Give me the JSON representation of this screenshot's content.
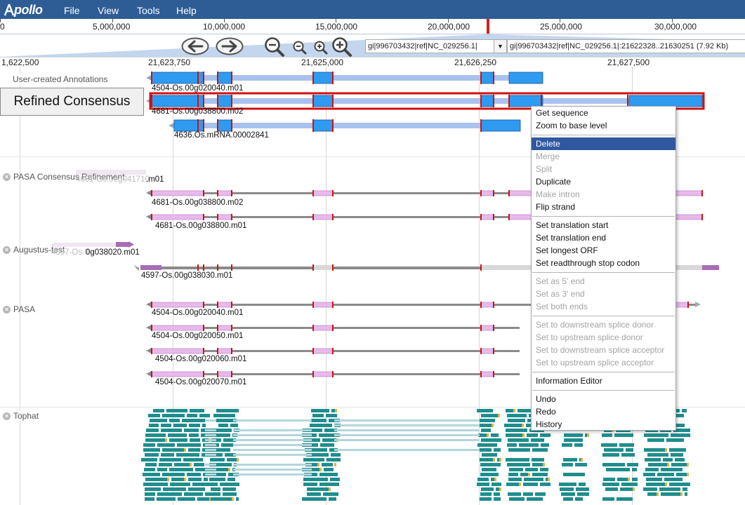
{
  "app": {
    "name": "Apollo",
    "logo_text": "pollo"
  },
  "menu": [
    "File",
    "View",
    "Tools",
    "Help"
  ],
  "overview": {
    "tick_labels": [
      "0",
      "5,000,000",
      "10,000,000",
      "15,000,000",
      "20,000,000",
      "25,000,000",
      "30,000,000"
    ]
  },
  "navigation": {
    "reference_sequence": "gi|996703432|ref|NC_029256.1|",
    "location": "gi|996703432|ref|NC_029256.1|:21622328..21630251 (7.92 Kb)"
  },
  "ruler": {
    "labels": [
      "1,622,500",
      "21,623,750",
      "21,625,000",
      "21,626,250",
      "21,627,500"
    ]
  },
  "highlight_label": "Refined Consensus",
  "tracks": {
    "user": {
      "label": "User-created Annotations",
      "features": [
        "4504-Os.00g020040.m01",
        "4681-Os.00g038800.m02",
        "4636.Os.mRNA.00002841"
      ]
    },
    "pasa_refine": {
      "label": "PASA Consensus Refinement",
      "ghost": "4681-Os.00g041710",
      "ghost_tail": ".m01",
      "features": [
        "4681-Os.00g038800.m02",
        "4681-Os.00g038800.m01"
      ]
    },
    "augustus": {
      "label": "Augustus-test",
      "ghost": "4597-Os.0",
      "ghost_tail": "0g038020.m01",
      "features": [
        "4597-Os.00g038030.m01"
      ]
    },
    "pasa": {
      "label": "PASA",
      "features": [
        "4504-Os.00g020040.m01",
        "4504-Os.00g020050.m01",
        "4504-Os.00g020060.m01",
        "4504-Os.00g020070.m01"
      ]
    },
    "tophat": {
      "label": "Tophat"
    }
  },
  "context_menu": {
    "items": [
      {
        "label": "Get sequence",
        "state": "enabled"
      },
      {
        "label": "Zoom to base level",
        "state": "enabled"
      },
      {
        "label": "Delete",
        "state": "selected"
      },
      {
        "label": "Merge",
        "state": "disabled"
      },
      {
        "label": "Split",
        "state": "disabled"
      },
      {
        "label": "Duplicate",
        "state": "enabled"
      },
      {
        "label": "Make intron",
        "state": "disabled"
      },
      {
        "label": "Flip strand",
        "state": "enabled"
      },
      {
        "label": "Set translation start",
        "state": "enabled"
      },
      {
        "label": "Set translation end",
        "state": "enabled"
      },
      {
        "label": "Set longest ORF",
        "state": "enabled"
      },
      {
        "label": "Set readthrough stop codon",
        "state": "enabled"
      },
      {
        "label": "Set as 5' end",
        "state": "disabled"
      },
      {
        "label": "Set as 3' end",
        "state": "disabled"
      },
      {
        "label": "Set both ends",
        "state": "disabled"
      },
      {
        "label": "Set to downstream splice donor",
        "state": "disabled"
      },
      {
        "label": "Set to upstream splice donor",
        "state": "disabled"
      },
      {
        "label": "Set to downstream splice acceptor",
        "state": "disabled"
      },
      {
        "label": "Set to upstream splice acceptor",
        "state": "disabled"
      },
      {
        "label": "Information Editor",
        "state": "enabled"
      },
      {
        "label": "Undo",
        "state": "enabled"
      },
      {
        "label": "Redo",
        "state": "enabled"
      },
      {
        "label": "History",
        "state": "enabled"
      }
    ]
  },
  "colors": {
    "menubar": "#2e5d96",
    "exon": "#2f9bf0",
    "utr": "#a9c1ef",
    "selection": "#d01010",
    "evidence_exon": "#e9b8ec",
    "evidence_intron": "#8a8a8a",
    "read": "#1f8d8e",
    "read_gap": "#b4d5dc"
  }
}
